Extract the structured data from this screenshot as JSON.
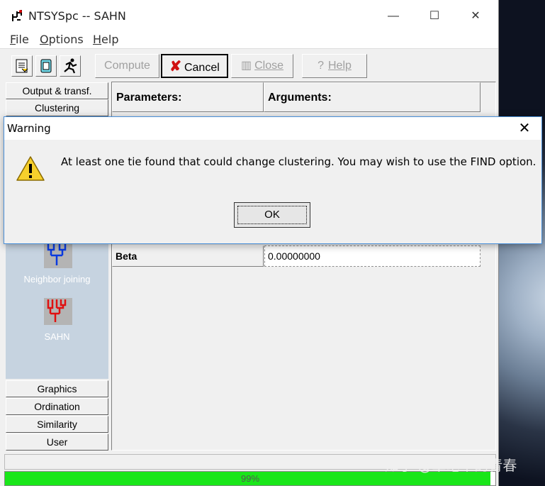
{
  "window": {
    "title": "NTSYSpc  -- SAHN",
    "controls": {
      "minimize": "—",
      "maximize": "☐",
      "close": "✕"
    }
  },
  "menu": {
    "items": [
      {
        "accel": "F",
        "rest": "ile"
      },
      {
        "accel": "O",
        "rest": "ptions"
      },
      {
        "accel": "H",
        "rest": "elp"
      }
    ]
  },
  "toolbar": {
    "compute_label": "Compute",
    "cancel_label": "Cancel",
    "close_label": "Close",
    "help_label": "Help",
    "cancel_icon": "x-icon-red"
  },
  "sidebar": {
    "tabs_top": [
      "Output & transf.",
      "Clustering"
    ],
    "tools": [
      {
        "label": "Neighbor joining",
        "icon": "tree-icon-blue",
        "color": "#0a3adf"
      },
      {
        "label": "SAHN",
        "icon": "tree-icon-red",
        "color": "#e01010"
      }
    ],
    "tabs_bottom": [
      "Graphics",
      "Ordination",
      "Similarity",
      "User"
    ],
    "panel_color": "#c6d3e0"
  },
  "grid": {
    "header_params": "Parameters:",
    "header_args": "Arguments:",
    "rows": [
      {
        "label": "Beta",
        "value": "0.00000000"
      }
    ]
  },
  "progress": {
    "label": "99%",
    "fraction": 0.99,
    "color": "#19e619"
  },
  "dialog": {
    "title": "Warning",
    "message": "At least one tie found that could change clustering.  You may wish to use the FIND option.",
    "ok_label": "OK",
    "icon": "warning-icon"
  },
  "watermark": "知乎 @单笔下的青春"
}
